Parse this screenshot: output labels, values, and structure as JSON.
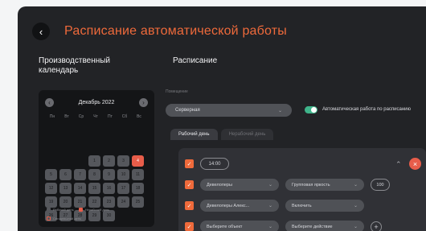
{
  "header": {
    "title": "Расписание автоматической работы",
    "back_icon": "‹"
  },
  "left_section_title": "Производственный календарь",
  "right_section_title": "Расписание",
  "calendar": {
    "month": "Декабрь 2022",
    "prev_icon": "‹",
    "next_icon": "›",
    "weekdays": [
      "Пн",
      "Вт",
      "Ср",
      "Чт",
      "Пт",
      "Сб",
      "Вс"
    ],
    "days": [
      {
        "label": "",
        "type": "empty"
      },
      {
        "label": "",
        "type": "empty"
      },
      {
        "label": "",
        "type": "empty"
      },
      {
        "label": "",
        "type": "empty"
      },
      {
        "label": "",
        "type": "empty"
      },
      {
        "label": "",
        "type": "empty"
      },
      {
        "label": "",
        "type": "empty"
      },
      {
        "label": "",
        "type": "empty"
      },
      {
        "label": "",
        "type": "empty"
      },
      {
        "label": "",
        "type": "empty"
      },
      {
        "label": "1",
        "type": "work"
      },
      {
        "label": "2",
        "type": "work"
      },
      {
        "label": "3",
        "type": "work"
      },
      {
        "label": "4",
        "type": "holiday"
      },
      {
        "label": "5",
        "type": "work"
      },
      {
        "label": "6",
        "type": "work"
      },
      {
        "label": "7",
        "type": "work"
      },
      {
        "label": "8",
        "type": "work"
      },
      {
        "label": "9",
        "type": "work"
      },
      {
        "label": "10",
        "type": "work"
      },
      {
        "label": "11",
        "type": "work"
      },
      {
        "label": "12",
        "type": "work"
      },
      {
        "label": "13",
        "type": "work"
      },
      {
        "label": "14",
        "type": "work"
      },
      {
        "label": "15",
        "type": "work"
      },
      {
        "label": "16",
        "type": "work"
      },
      {
        "label": "17",
        "type": "work"
      },
      {
        "label": "18",
        "type": "work"
      },
      {
        "label": "19",
        "type": "work"
      },
      {
        "label": "20",
        "type": "work"
      },
      {
        "label": "21",
        "type": "work"
      },
      {
        "label": "22",
        "type": "work"
      },
      {
        "label": "23",
        "type": "work"
      },
      {
        "label": "24",
        "type": "work"
      },
      {
        "label": "25",
        "type": "work"
      },
      {
        "label": "26",
        "type": "work"
      },
      {
        "label": "27",
        "type": "work"
      },
      {
        "label": "28",
        "type": "work"
      },
      {
        "label": "29",
        "type": "work"
      },
      {
        "label": "30",
        "type": "work"
      },
      {
        "label": "",
        "type": "empty"
      },
      {
        "label": "",
        "type": "empty"
      }
    ],
    "legend": {
      "workday": "Рабочий день",
      "nonworkday": "Нерабочий день",
      "today": "Сегодняшний день"
    }
  },
  "room": {
    "label": "Помещение",
    "value": "Серверная",
    "chevron_icon": "⌄"
  },
  "auto_toggle": {
    "label": "Автоматическая работа по расписанию",
    "on": true
  },
  "tabs": [
    {
      "label": "Рабочий день",
      "active": true
    },
    {
      "label": "Нерабочий день",
      "active": false
    }
  ],
  "rules": {
    "time": "14:00",
    "rows": [
      {
        "device": "Девелоперы",
        "action": "Групповая яркость",
        "value": "100"
      },
      {
        "device": "Девелоперы Алекс...",
        "action": "Включить",
        "value": ""
      },
      {
        "device": "Выберите объект",
        "action": "Выберите действие",
        "value": ""
      }
    ],
    "check_icon": "✓",
    "close_icon": "×",
    "collapse_icon": "⌃",
    "add_icon": "+"
  },
  "colors": {
    "accent": "#ef6a3b",
    "toggle_on": "#3fb48a",
    "holiday": "#e85d4a"
  }
}
